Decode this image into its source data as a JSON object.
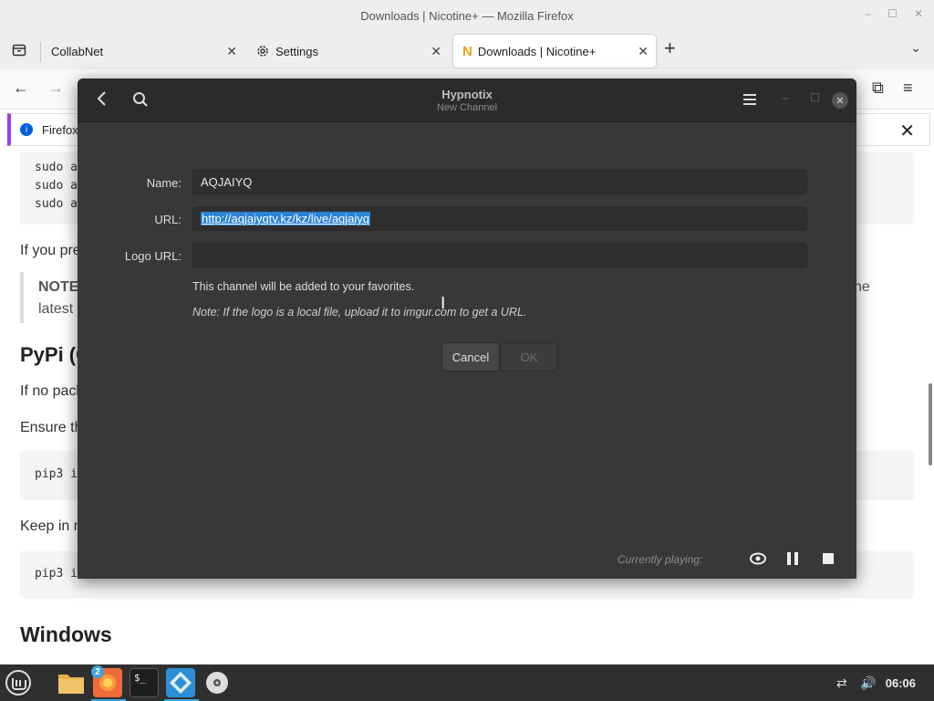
{
  "window": {
    "title": "Downloads | Nicotine+ — Mozilla Firefox"
  },
  "tabs": [
    {
      "label": "CollabNet"
    },
    {
      "label": "Settings"
    },
    {
      "label": "Downloads | Nicotine+"
    }
  ],
  "notification": {
    "text": "Firefox"
  },
  "page": {
    "code1": [
      "sudo a",
      "sudo a",
      "sudo a"
    ],
    "text_if_you": "If you pre",
    "note": "NOTE",
    "note_line2": "latest",
    "note_tail": "he",
    "heading_pypi": "PyPi (C",
    "text_if_no": "If no pack",
    "text_ensure": "Ensure th",
    "code2": "pip3 i",
    "text_keep": "Keep in m",
    "code3": "pip3 i",
    "heading_windows": "Windows"
  },
  "hypnotix": {
    "title": "Hypnotix",
    "subtitle": "New Channel",
    "fields": {
      "name_label": "Name:",
      "name_value": "AQJAIYQ",
      "url_label": "URL:",
      "url_value": "http://aqjaiyqtv.kz/kz/live/aqjaiyq",
      "logo_label": "Logo URL:",
      "logo_value": ""
    },
    "info_text": "This channel will be added to your favorites.",
    "note_text": "Note: If the logo is a local file, upload it to imgur.com to get a URL.",
    "cancel_label": "Cancel",
    "ok_label": "OK",
    "currently_playing": "Currently playing:"
  },
  "taskbar": {
    "badge_count": "2",
    "clock": "06:06"
  },
  "colors": {
    "dialog_bg": "#383838",
    "header_bg": "#2b2b2b",
    "selection": "#2b83d6",
    "taskbar": "#2f2f2f",
    "accent": "#3ea3d9"
  }
}
